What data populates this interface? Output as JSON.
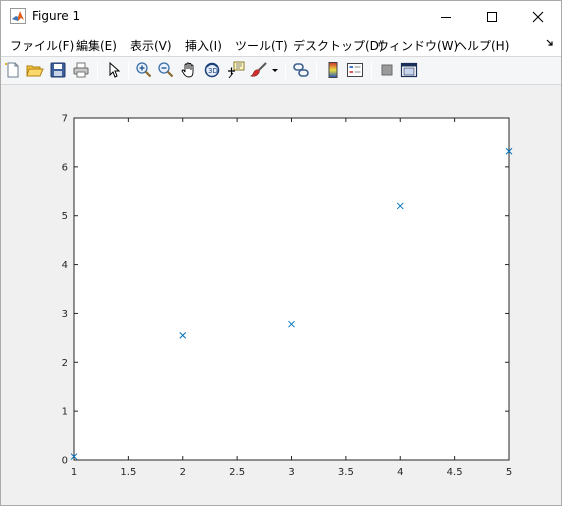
{
  "window": {
    "title": "Figure 1",
    "icon": "matlab-icon"
  },
  "controls": {
    "minimize_icon": "minimize-icon",
    "maximize_icon": "maximize-icon",
    "close_icon": "close-icon"
  },
  "menu": {
    "items": [
      {
        "label": "ファイル(F)"
      },
      {
        "label": "編集(E)"
      },
      {
        "label": "表示(V)"
      },
      {
        "label": "挿入(I)"
      },
      {
        "label": "ツール(T)"
      },
      {
        "label": "デスクトップ(D)"
      },
      {
        "label": "ウィンドウ(W)"
      },
      {
        "label": "ヘルプ(H)"
      }
    ],
    "overflow_icon": "dock-arrow-icon"
  },
  "toolbar": {
    "icons": [
      "new-figure-icon",
      "open-file-icon",
      "save-icon",
      "print-icon",
      "edit-plot-arrow-icon",
      "zoom-in-icon",
      "zoom-out-icon",
      "pan-hand-icon",
      "rotate-3d-icon",
      "data-cursor-icon",
      "brush-icon",
      "brush-dropdown-icon",
      "link-plot-icon",
      "insert-colorbar-icon",
      "insert-legend-icon",
      "hide-plot-tools-icon",
      "show-plot-tools-icon"
    ]
  },
  "colors": {
    "marker": "#0072bd",
    "axes": "#262626",
    "figure_background": "#f0f0f0"
  },
  "chart_data": {
    "type": "scatter",
    "marker": "x",
    "title": "",
    "xlabel": "",
    "ylabel": "",
    "xlim": [
      1,
      5
    ],
    "ylim": [
      0,
      7
    ],
    "xticks": [
      "1",
      "1.5",
      "2",
      "2.5",
      "3",
      "3.5",
      "4",
      "4.5",
      "5"
    ],
    "yticks": [
      "0",
      "1",
      "2",
      "3",
      "4",
      "5",
      "6",
      "7"
    ],
    "grid": false,
    "points": [
      {
        "x": 1,
        "y": 0.07
      },
      {
        "x": 2,
        "y": 2.55
      },
      {
        "x": 3,
        "y": 2.78
      },
      {
        "x": 4,
        "y": 5.2
      },
      {
        "x": 5,
        "y": 6.32
      }
    ]
  }
}
